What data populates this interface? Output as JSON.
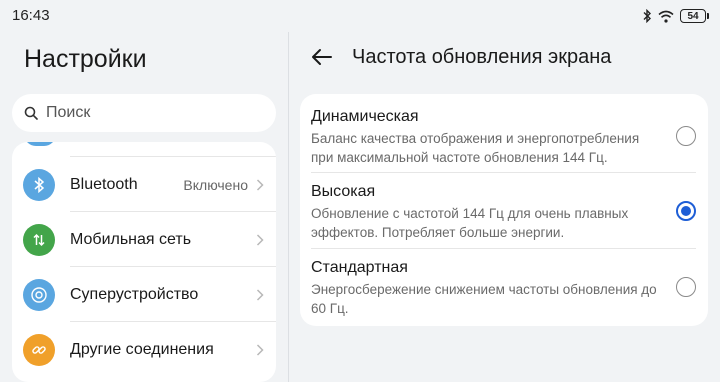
{
  "status_bar": {
    "time": "16:43",
    "battery": "54",
    "icons": [
      "bluetooth-icon",
      "wifi-icon",
      "battery-icon"
    ]
  },
  "left_pane": {
    "title": "Настройки",
    "search_placeholder": "Поиск",
    "items": [
      {
        "label": "Bluetooth",
        "value": "Включено",
        "icon": "bluetooth-icon",
        "color": "#5aa6e0"
      },
      {
        "label": "Мобильная сеть",
        "value": "",
        "icon": "mobile-data-icon",
        "color": "#43a54a"
      },
      {
        "label": "Суперустройство",
        "value": "",
        "icon": "super-device-icon",
        "color": "#5aa6e0"
      },
      {
        "label": "Другие соединения",
        "value": "",
        "icon": "link-icon",
        "color": "#f0a02a"
      }
    ]
  },
  "right_pane": {
    "title": "Частота обновления экрана",
    "options": [
      {
        "title": "Динамическая",
        "desc": "Баланс качества отображения и энергопотребления при максимальной частоте обновления 144 Гц.",
        "selected": false
      },
      {
        "title": "Высокая",
        "desc": "Обновление с частотой 144 Гц для очень плавных эффектов. Потребляет больше энергии.",
        "selected": true
      },
      {
        "title": "Стандартная",
        "desc": "Энергосбережение снижением частоты обновления до 60 Гц.",
        "selected": false
      }
    ]
  },
  "colors": {
    "accent": "#1e5ed6",
    "background": "#f1f3f5"
  }
}
